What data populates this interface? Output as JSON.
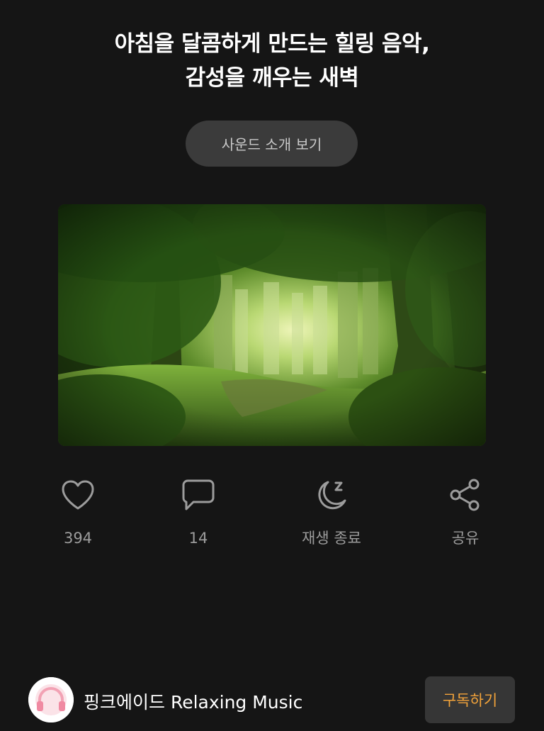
{
  "header": {
    "title_line1": "아침을 달콤하게 만드는 힐링 음악,",
    "title_line2": "감성을 깨우는 새벽"
  },
  "intro_button": {
    "label": "사운드 소개 보기"
  },
  "actions": [
    {
      "icon": "heart-icon",
      "label": "394"
    },
    {
      "icon": "comment-icon",
      "label": "14"
    },
    {
      "icon": "moon-sleep-icon",
      "label": "재생 종료"
    },
    {
      "icon": "share-icon",
      "label": "공유"
    }
  ],
  "channel": {
    "name": "핑크에이드 Relaxing Music",
    "avatar_icon": "headphones-icon",
    "subscribe_label": "구독하기"
  },
  "colors": {
    "background": "#151515",
    "accent": "#f2a33a",
    "icon": "#9c9c9c"
  }
}
